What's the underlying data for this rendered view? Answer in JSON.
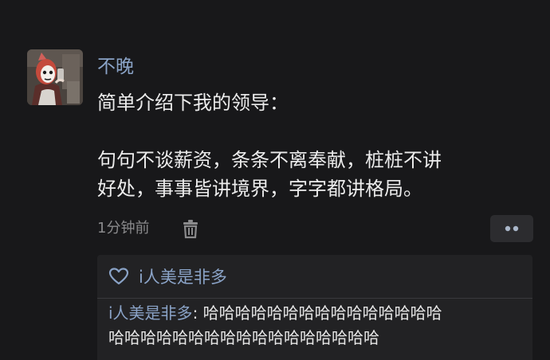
{
  "post": {
    "username": "不晚",
    "lines": [
      "简单介绍下我的领导：",
      "句句不谈薪资，条条不离奉献，桩桩不讲",
      "好处，事事皆讲境界，字字都讲格局。"
    ],
    "timestamp": "1分钟前"
  },
  "comments": {
    "likes": "i人美是非多",
    "reply": {
      "author": "i人美是非多",
      "separator": ": ",
      "text_line1": "哈哈哈哈哈哈哈哈哈哈哈哈哈哈哈",
      "text_line2": "哈哈哈哈哈哈哈哈哈哈哈哈哈哈哈哈哈"
    }
  },
  "icons": {
    "trash": "trash-icon",
    "more": "more-dots-icon",
    "heart": "heart-icon"
  },
  "colors": {
    "background": "#18181a",
    "username": "#8aa3c7",
    "text": "#ececec",
    "muted": "#8a8a8c",
    "panel": "#222224"
  }
}
